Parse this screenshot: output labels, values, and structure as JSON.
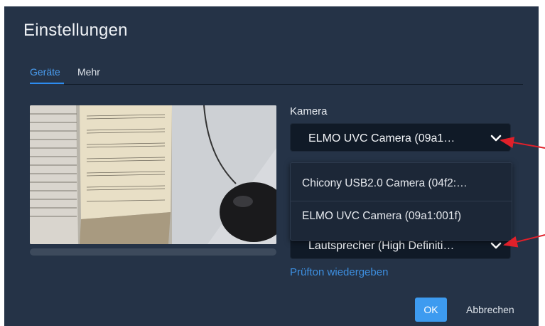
{
  "dialog": {
    "title": "Einstellungen",
    "tabs": [
      {
        "label": "Geräte",
        "active": true
      },
      {
        "label": "Mehr",
        "active": false
      }
    ],
    "camera": {
      "label": "Kamera",
      "selected": "ELMO UVC Camera (09a1…",
      "icon": "chevron-down-icon"
    },
    "camera_options": [
      {
        "label": "Chicony USB2.0 Camera (04f2:…"
      },
      {
        "label": "ELMO UVC Camera (09a1:001f)"
      }
    ],
    "speaker": {
      "selected": "Lautsprecher (High Definiti…",
      "icon": "chevron-down-icon"
    },
    "test_link": "Prüfton wiedergeben",
    "ok_label": "OK",
    "cancel_label": "Abbrechen"
  },
  "colors": {
    "dialog_bg": "#253347",
    "accent": "#2d8cf0",
    "select_bg": "#101a27",
    "annotation_arrow": "#e0202a"
  }
}
